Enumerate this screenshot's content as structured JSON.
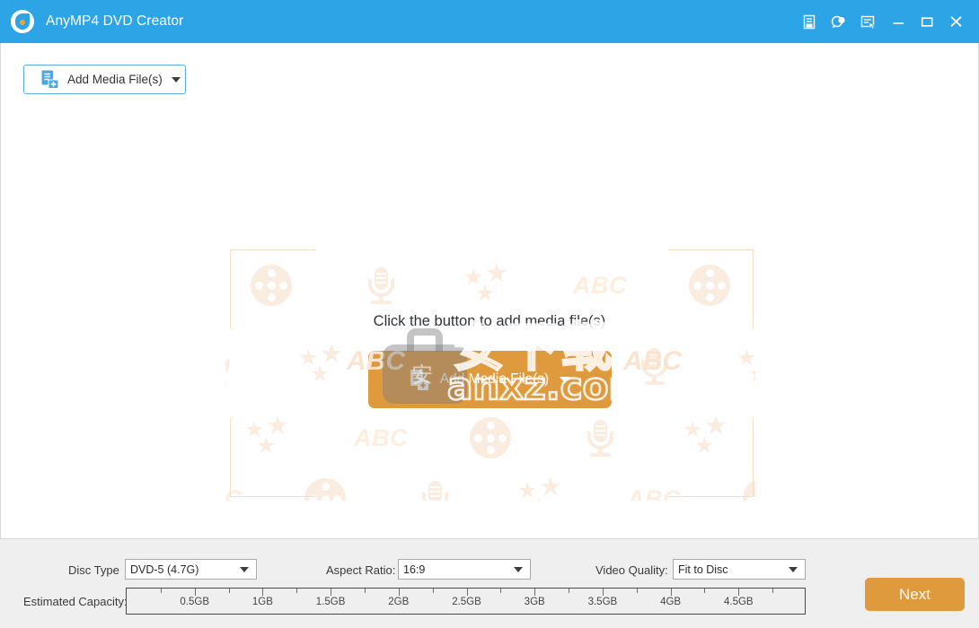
{
  "window": {
    "title": "AnyMP4 DVD Creator",
    "logo_icon": "anymp4-drop-logo-icon",
    "controls": [
      {
        "name": "register-icon",
        "label": "Register"
      },
      {
        "name": "feedback-icon",
        "label": "Feedback"
      },
      {
        "name": "menu-icon",
        "label": "Menu"
      },
      {
        "name": "minimize-icon",
        "label": "Minimize"
      },
      {
        "name": "maximize-icon",
        "label": "Maximize"
      },
      {
        "name": "close-icon",
        "label": "Close"
      }
    ]
  },
  "toolbar": {
    "add_media_label": "Add Media File(s)",
    "add_media_icon": "add-file-icon",
    "caret_icon": "chevron-down-icon"
  },
  "dropzone": {
    "hint": "Click the button to add media file(s)",
    "button_label": "Add Media File(s)",
    "button_icon": "add-file-icon",
    "button_color": "#e09a3e",
    "watermark_pattern": [
      "film-reel-icon",
      "microphone-icon",
      "stars-icon",
      "ABC"
    ],
    "pattern_text": "ABC"
  },
  "watermark": {
    "chinese": "安下载",
    "url": "anxz.com",
    "bag_char": "安",
    "side_text": "ABC"
  },
  "bottom": {
    "disc_type": {
      "label": "Disc Type",
      "value": "DVD-5 (4.7G)",
      "focused": true
    },
    "aspect_ratio": {
      "label": "Aspect Ratio:",
      "value": "16:9",
      "focused": false
    },
    "video_quality": {
      "label": "Video Quality:",
      "value": "Fit to Disc",
      "focused": false
    },
    "capacity": {
      "label": "Estimated Capacity:",
      "ticks": [
        "0.5GB",
        "1GB",
        "1.5GB",
        "2GB",
        "2.5GB",
        "3GB",
        "3.5GB",
        "4GB",
        "4.5GB"
      ],
      "used": 0
    },
    "next_label": "Next"
  },
  "colors": {
    "titlebar": "#2da4e5",
    "accent_orange": "#e09a3e",
    "panel": "#efefef",
    "watermark_orange": "#fbece0"
  }
}
